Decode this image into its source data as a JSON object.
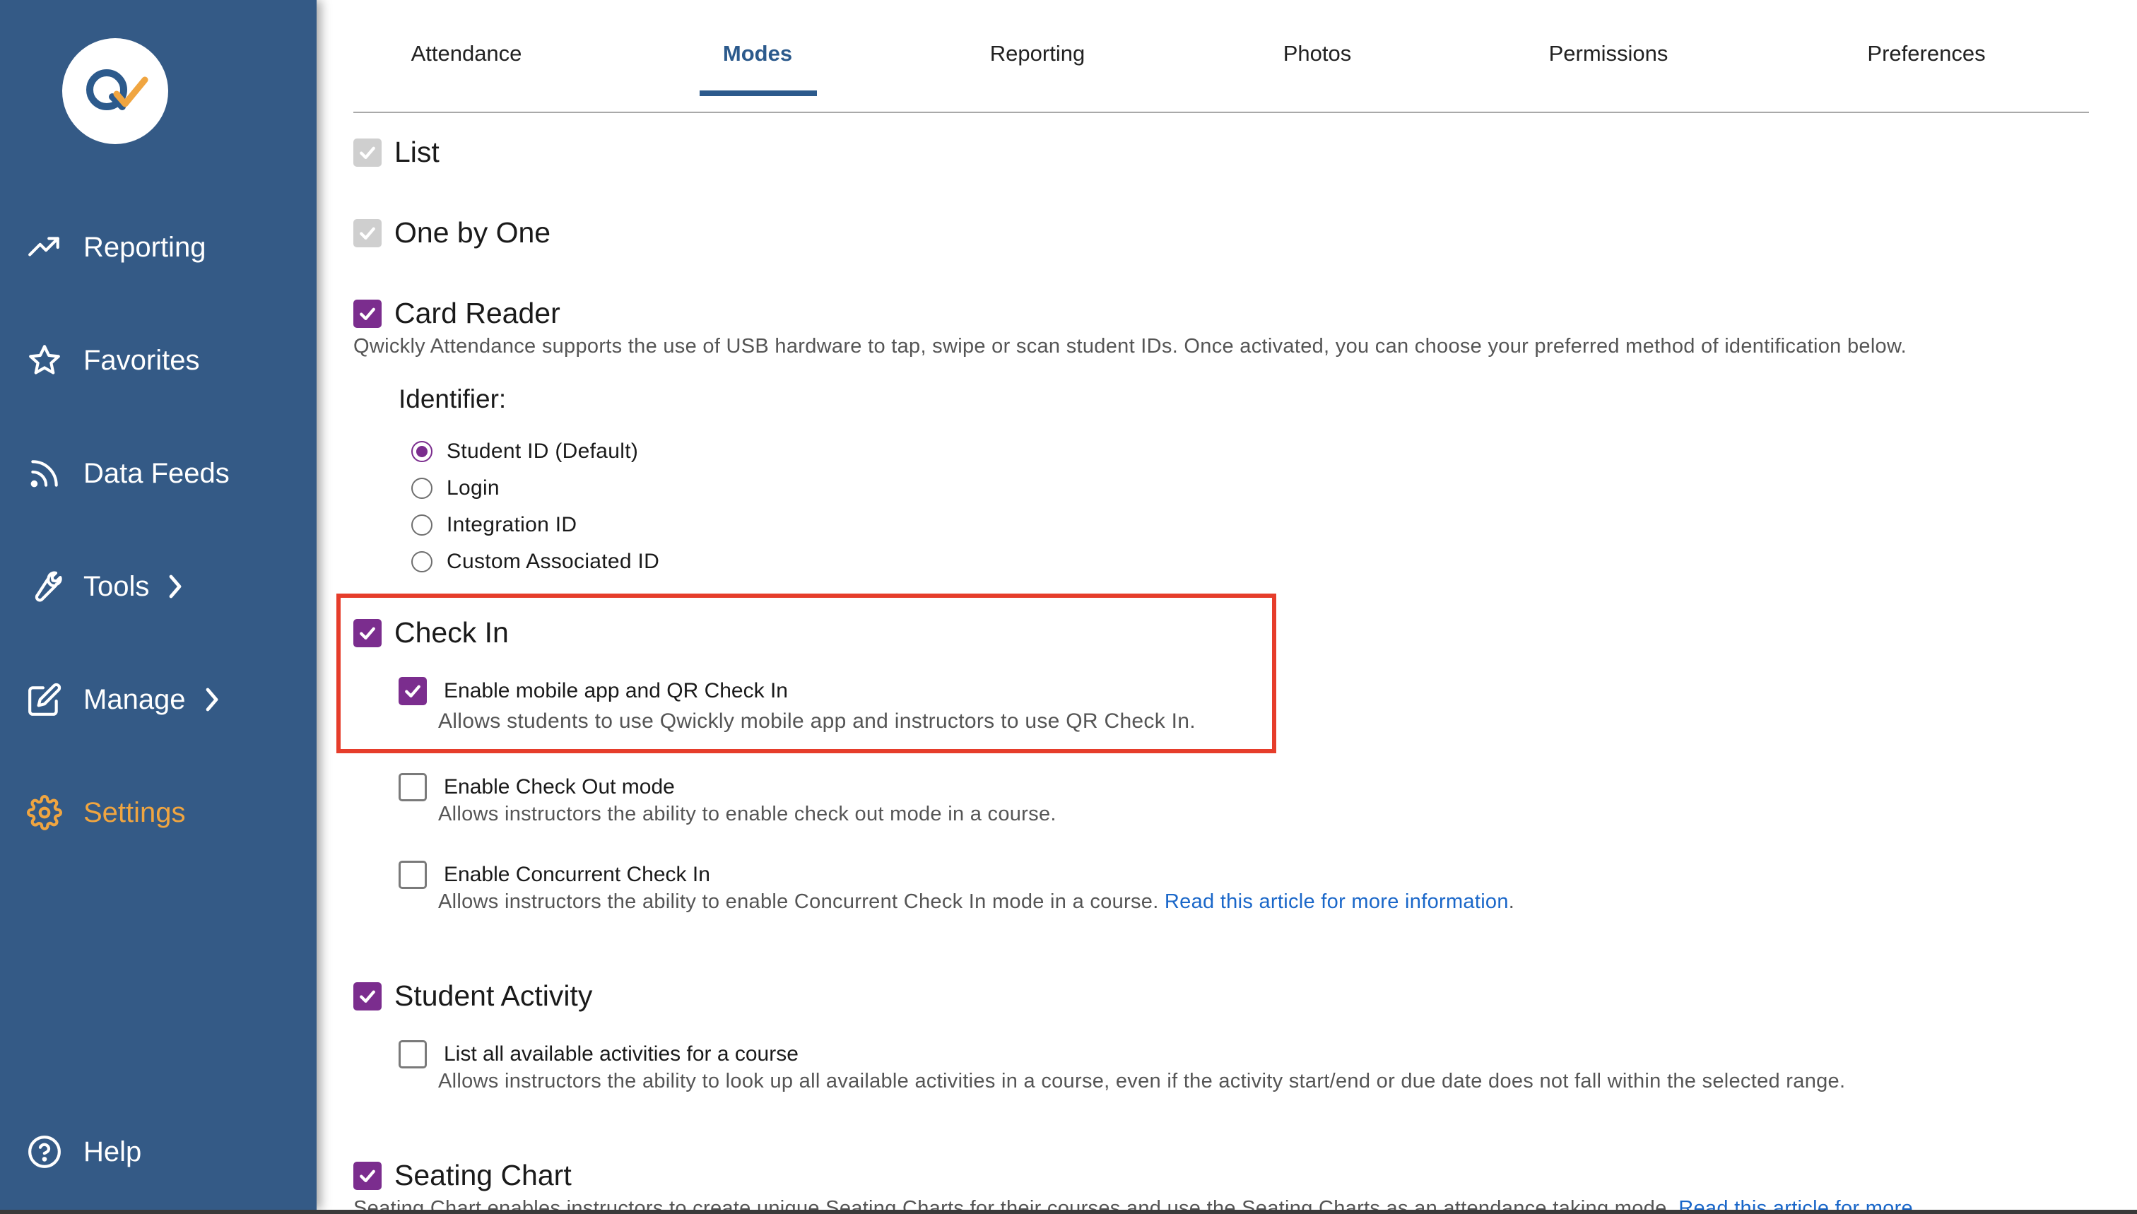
{
  "sidebar": {
    "logo_icon": "qwickly-logo",
    "brand_colors": {
      "background": "#345a86",
      "active": "#f0a540",
      "logo_q": "#2c5a8c",
      "logo_check": "#f0a540"
    },
    "items": [
      {
        "label": "Reporting",
        "icon": "trend-up-icon"
      },
      {
        "label": "Favorites",
        "icon": "star-icon"
      },
      {
        "label": "Data Feeds",
        "icon": "rss-icon"
      },
      {
        "label": "Tools",
        "icon": "wrench-icon",
        "has_submenu": true
      },
      {
        "label": "Manage",
        "icon": "edit-icon",
        "has_submenu": true
      },
      {
        "label": "Settings",
        "icon": "gear-icon",
        "active": true
      }
    ],
    "help_label": "Help"
  },
  "tabs": [
    {
      "label": "Attendance"
    },
    {
      "label": "Modes",
      "active": true
    },
    {
      "label": "Reporting"
    },
    {
      "label": "Photos"
    },
    {
      "label": "Permissions"
    },
    {
      "label": "Preferences"
    }
  ],
  "modes": {
    "list": {
      "label": "List",
      "checked": true,
      "disabled": true
    },
    "one_by_one": {
      "label": "One by One",
      "checked": true,
      "disabled": true
    },
    "card_reader": {
      "label": "Card Reader",
      "checked": true,
      "description": "Qwickly Attendance supports the use of USB hardware to tap, swipe or scan student IDs. Once activated, you can choose your preferred method of identification below.",
      "identifier_label": "Identifier:",
      "identifier_options": [
        {
          "label": "Student ID (Default)",
          "selected": true
        },
        {
          "label": "Login",
          "selected": false
        },
        {
          "label": "Integration ID",
          "selected": false
        },
        {
          "label": "Custom Associated ID",
          "selected": false
        }
      ]
    },
    "check_in": {
      "label": "Check In",
      "checked": true,
      "options": [
        {
          "label": "Enable mobile app and QR Check In",
          "checked": true,
          "description": "Allows students to use Qwickly mobile app and instructors to use QR Check In."
        },
        {
          "label": "Enable Check Out mode",
          "checked": false,
          "description": "Allows instructors the ability to enable check out mode in a course."
        },
        {
          "label": "Enable Concurrent Check In",
          "checked": false,
          "description": "Allows instructors the ability to enable Concurrent Check In mode in a course.",
          "link": "Read this article for more information",
          "link_suffix": "."
        }
      ]
    },
    "student_activity": {
      "label": "Student Activity",
      "checked": true,
      "options": [
        {
          "label": "List all available activities for a course",
          "checked": false,
          "description": "Allows instructors the ability to look up all available activities in a course, even if the activity start/end or due date does not fall within the selected range."
        }
      ]
    },
    "seating_chart": {
      "label": "Seating Chart",
      "checked": true,
      "description": "Seating Chart enables instructors to create unique Seating Charts for their courses and use the Seating Charts as an attendance taking mode.",
      "link": "Read this article for more"
    }
  },
  "colors": {
    "checkbox": "#7b2d8e",
    "link": "#1a67c9",
    "highlight": "#e63d2b",
    "tab_active": "#2c5a8c"
  }
}
